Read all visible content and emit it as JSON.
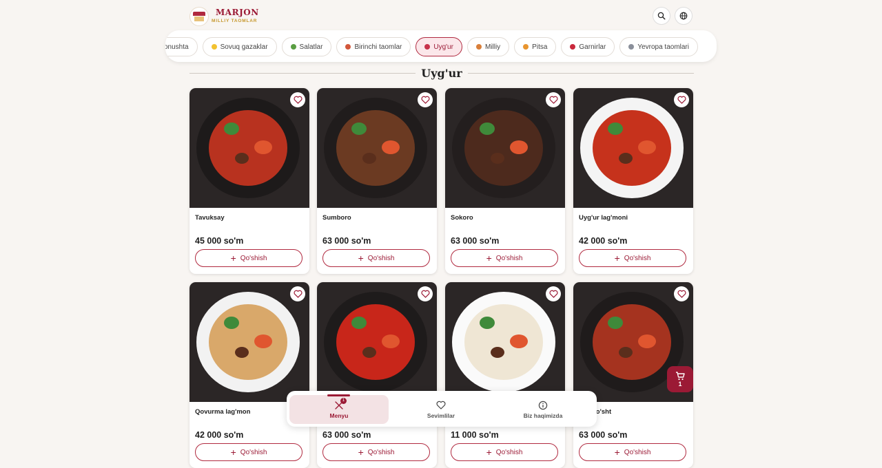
{
  "brand": {
    "name": "MARJON",
    "subtitle": "MILLIY TAOMLAR"
  },
  "categories": [
    {
      "label": "onushta",
      "icon": "breakfast-icon",
      "color": "#e0a24a",
      "active": false
    },
    {
      "label": "Sovuq gazaklar",
      "icon": "cheese-icon",
      "color": "#f2c230",
      "active": false
    },
    {
      "label": "Salatlar",
      "icon": "salad-icon",
      "color": "#5a9e43",
      "active": false
    },
    {
      "label": "Birinchi taomlar",
      "icon": "soup-icon",
      "color": "#d2573b",
      "active": false
    },
    {
      "label": "Uyg'ur",
      "icon": "noodle-bowl-icon",
      "color": "#c7314a",
      "active": true
    },
    {
      "label": "Milliy",
      "icon": "pot-icon",
      "color": "#d97f3a",
      "active": false
    },
    {
      "label": "Pitsa",
      "icon": "pizza-icon",
      "color": "#e8952f",
      "active": false
    },
    {
      "label": "Garnirlar",
      "icon": "rice-bowl-icon",
      "color": "#c9283c",
      "active": false
    },
    {
      "label": "Yevropa taomlari",
      "icon": "plate-icon",
      "color": "#8a8f9a",
      "active": false
    }
  ],
  "section_title": "Uyg'ur",
  "products": [
    {
      "name": "Tavuksay",
      "price": "45 000 so'm",
      "add_label": "Qo'shish",
      "sauce": "#b8321f",
      "plate": "#1d1a1a"
    },
    {
      "name": "Sumboro",
      "price": "63 000 so'm",
      "add_label": "Qo'shish",
      "sauce": "#6b3a22",
      "plate": "#201c1c"
    },
    {
      "name": "Sokoro",
      "price": "63 000 so'm",
      "add_label": "Qo'shish",
      "sauce": "#4d2a1d",
      "plate": "#231e1e"
    },
    {
      "name": "Uyg'ur lag'moni",
      "price": "42 000 so'm",
      "add_label": "Qo'shish",
      "sauce": "#c6321c",
      "plate": "#f4f4f4"
    },
    {
      "name": "Qovurma lag'mon",
      "price": "42 000 so'm",
      "add_label": "Qo'shish",
      "sauce": "#d9a86a",
      "plate": "#f2f2f2"
    },
    {
      "name": "",
      "price": "63 000 so'm",
      "add_label": "Qo'shish",
      "sauce": "#c8261a",
      "plate": "#1e1b1b"
    },
    {
      "name": "",
      "price": "11 000 so'm",
      "add_label": "Qo'shish",
      "sauce": "#efe6d4",
      "plate": "#fafafa"
    },
    {
      "name": "cha go'sht",
      "price": "63 000 so'm",
      "add_label": "Qo'shish",
      "sauce": "#a5331f",
      "plate": "#1f1b1b"
    }
  ],
  "bottom_nav": [
    {
      "label": "Menyu",
      "icon": "utensils-icon",
      "active": true,
      "badge": "1"
    },
    {
      "label": "Sevimlilar",
      "icon": "heart-icon",
      "active": false
    },
    {
      "label": "Biz haqimizda",
      "icon": "info-icon",
      "active": false
    }
  ],
  "cart": {
    "count": "1"
  },
  "colors": {
    "accent": "#9b1a35",
    "gold": "#c6972c",
    "background": "#f8f5f2"
  }
}
